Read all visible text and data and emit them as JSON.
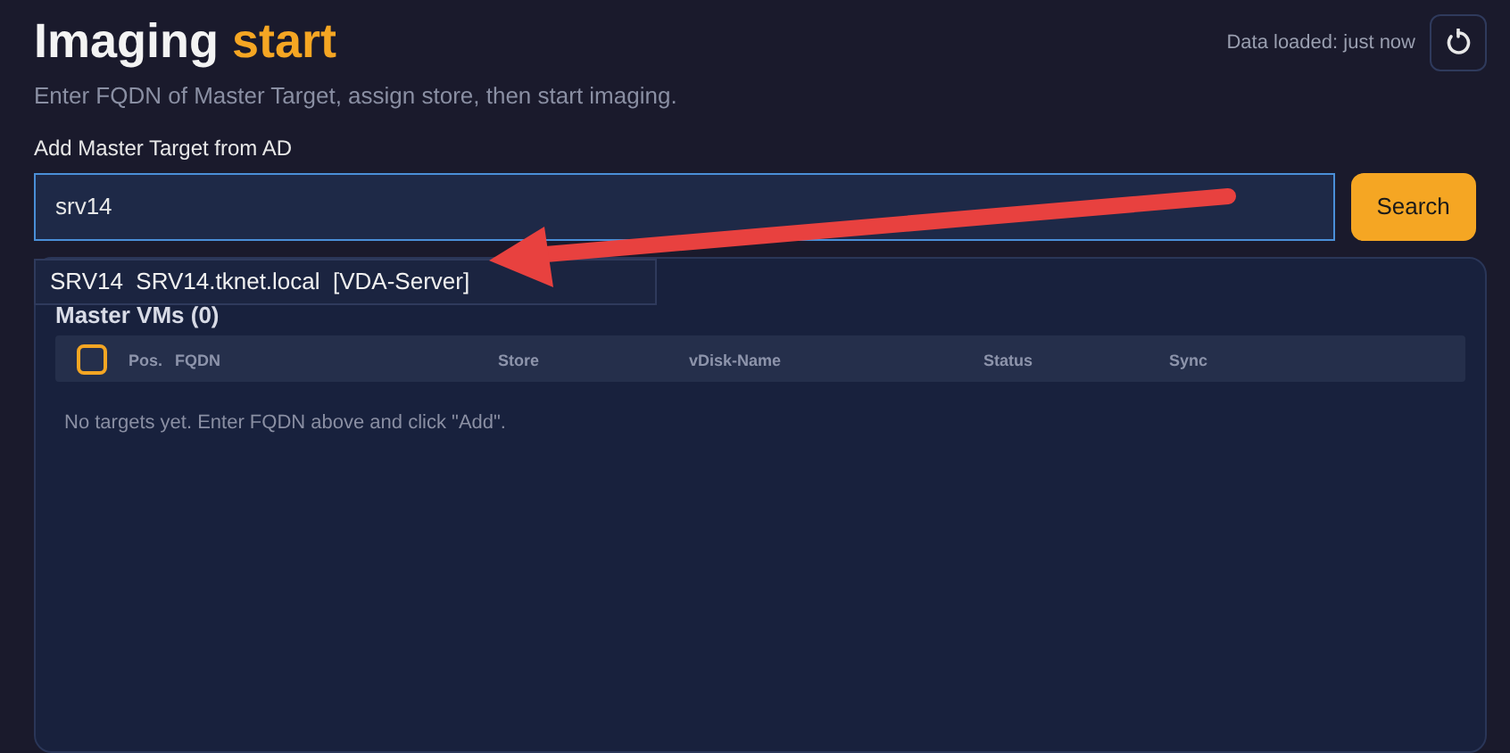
{
  "header": {
    "title": "Imaging",
    "title_accent": "start",
    "subtitle": "Enter FQDN of Master Target, assign store, then start imaging.",
    "status": "Data loaded: just now"
  },
  "search": {
    "label": "Add Master Target from AD",
    "value": "srv14",
    "button": "Search"
  },
  "suggestions": [
    {
      "text": "SRV14  SRV14.tknet.local  [VDA-Server]"
    }
  ],
  "panel": {
    "title": "Master VMs (0)",
    "select_all": {
      "checked": false
    },
    "columns": [
      "Pos.",
      "FQDN",
      "Store",
      "vDisk-Name",
      "Status",
      "Sync"
    ],
    "empty_message": "No targets yet. Enter FQDN above and click \"Add\"."
  },
  "annotation": {
    "kind": "arrow"
  }
}
